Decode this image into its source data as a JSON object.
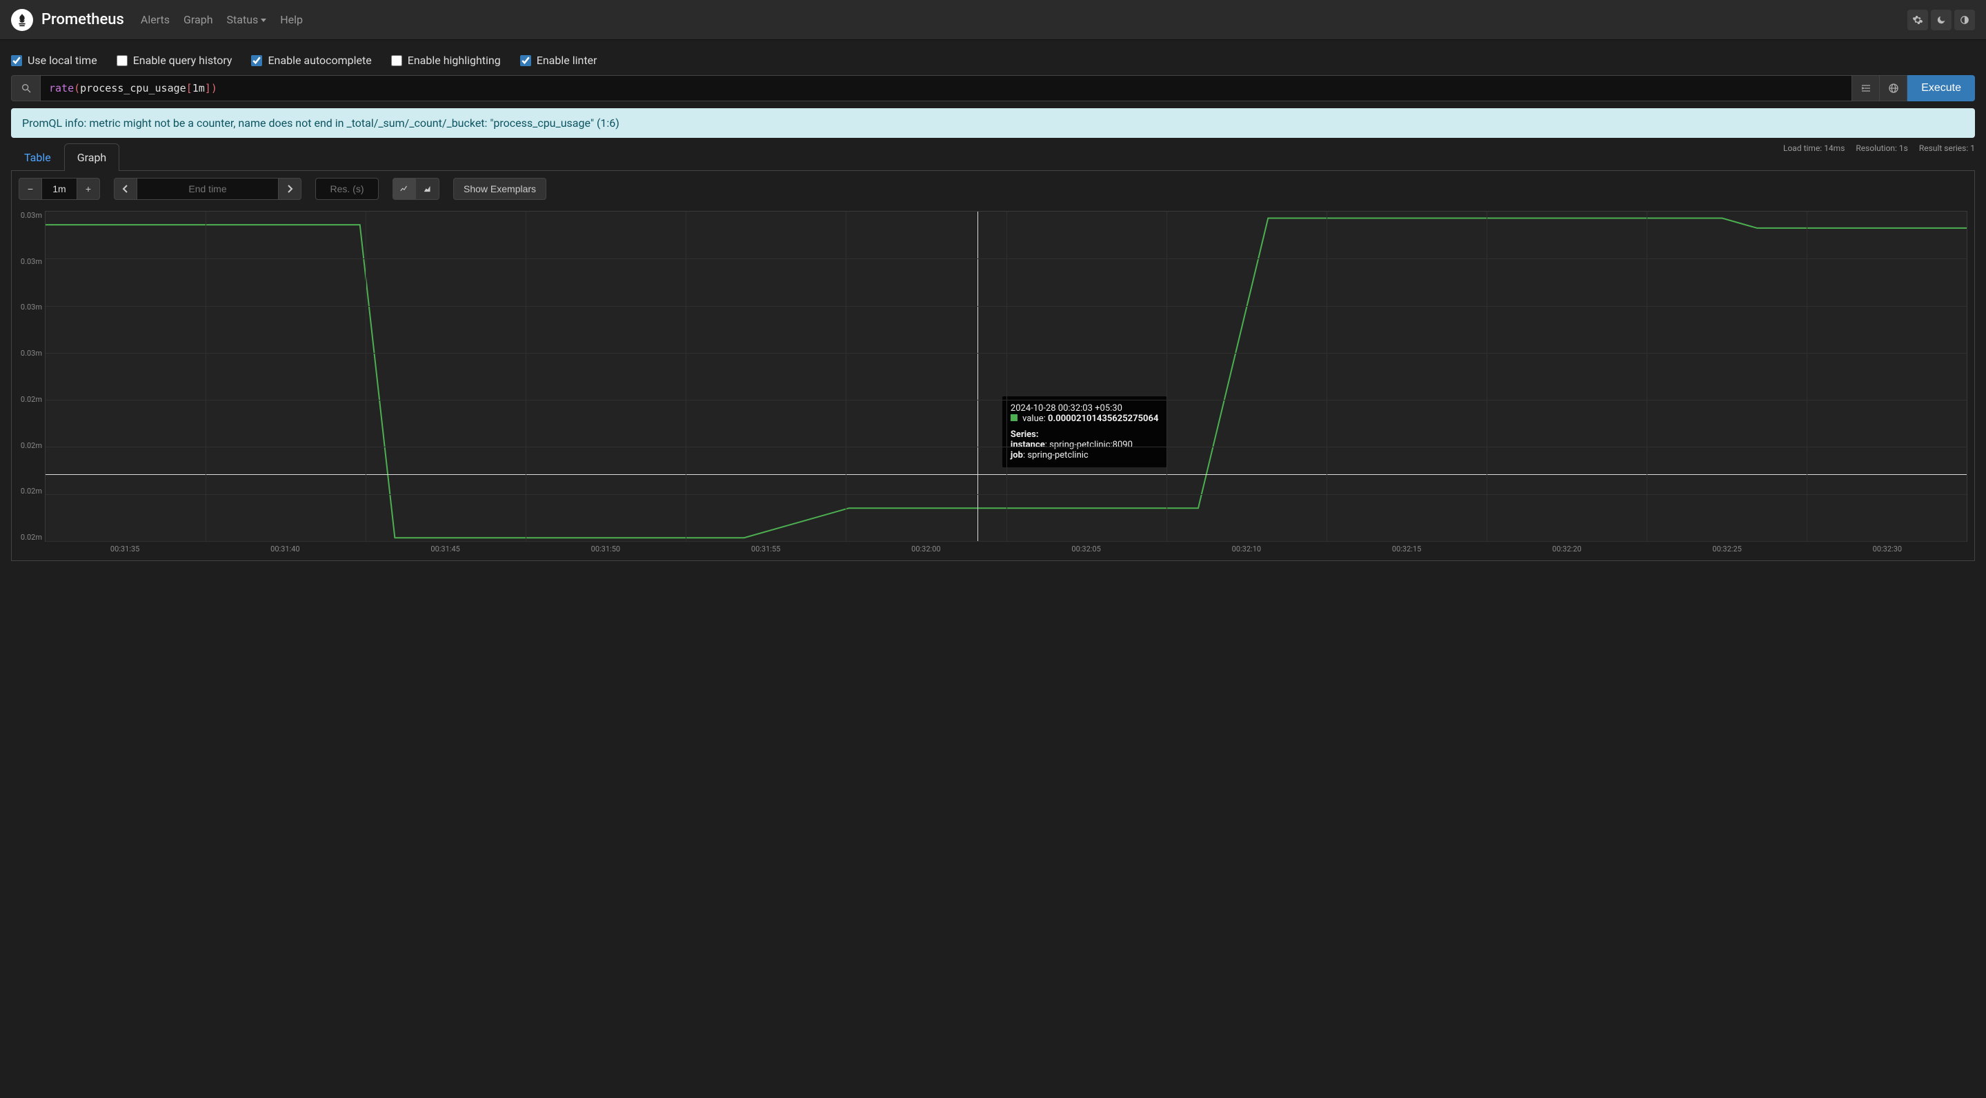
{
  "navbar": {
    "brand": "Prometheus",
    "links": [
      "Alerts",
      "Graph",
      "Status",
      "Help"
    ]
  },
  "options": [
    {
      "label": "Use local time",
      "checked": true
    },
    {
      "label": "Enable query history",
      "checked": false
    },
    {
      "label": "Enable autocomplete",
      "checked": true
    },
    {
      "label": "Enable highlighting",
      "checked": false
    },
    {
      "label": "Enable linter",
      "checked": true
    }
  ],
  "query": {
    "expression": "rate(process_cpu_usage[1m])",
    "execute_label": "Execute"
  },
  "alert": "PromQL info: metric might not be a counter, name does not end in _total/_sum/_count/_bucket: \"process_cpu_usage\" (1:6)",
  "tabs": {
    "table": "Table",
    "graph": "Graph",
    "active": "Graph"
  },
  "stats": {
    "load_time": "Load time: 14ms",
    "resolution": "Resolution: 1s",
    "result_series": "Result series: 1"
  },
  "controls": {
    "time_range": "1m",
    "end_time_placeholder": "End time",
    "res_placeholder": "Res. (s)",
    "show_exemplars": "Show Exemplars"
  },
  "tooltip": {
    "timestamp": "2024-10-28 00:32:03 +05:30",
    "value_label": "value: ",
    "value": "0.00002101435625275064",
    "series_label": "Series:",
    "instance_key": "instance",
    "instance_val": "spring-petclinic:8090",
    "job_key": "job",
    "job_val": "spring-petclinic"
  },
  "chart_data": {
    "type": "line",
    "title": "",
    "xlabel": "",
    "ylabel": "",
    "y_ticks": [
      "0.03m",
      "0.03m",
      "0.03m",
      "0.03m",
      "0.02m",
      "0.02m",
      "0.02m",
      "0.02m"
    ],
    "x_ticks": [
      "00:31:35",
      "00:31:40",
      "00:31:45",
      "00:31:50",
      "00:31:55",
      "00:32:00",
      "00:32:05",
      "00:32:10",
      "00:32:15",
      "00:32:20",
      "00:32:25",
      "00:32:30"
    ],
    "ylim": [
      2e-05,
      3e-05
    ],
    "series": [
      {
        "name": "spring-petclinic",
        "color": "#4caf50",
        "x": [
          "00:31:35",
          "00:31:40",
          "00:31:44",
          "00:31:45",
          "00:31:55",
          "00:31:58",
          "00:32:00",
          "00:32:08",
          "00:32:10",
          "00:32:23",
          "00:32:24",
          "00:32:30"
        ],
        "values": [
          2.96e-05,
          2.96e-05,
          2.96e-05,
          2.01e-05,
          2.01e-05,
          2.1e-05,
          2.1e-05,
          2.1e-05,
          2.98e-05,
          2.98e-05,
          2.95e-05,
          2.95e-05
        ]
      }
    ],
    "crosshair_x": "00:32:03",
    "crosshair_y": 2.1e-05
  }
}
